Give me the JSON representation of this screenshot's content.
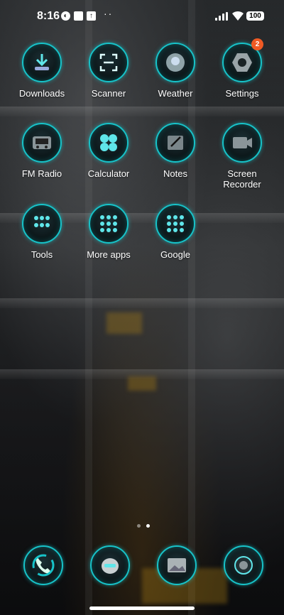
{
  "status_bar": {
    "time": "8:16",
    "notif_icons": [
      "assistant-icon",
      "photo-icon",
      "upload-icon"
    ],
    "battery": "100"
  },
  "apps": [
    {
      "label": "Downloads",
      "icon": "download-icon"
    },
    {
      "label": "Scanner",
      "icon": "scanner-icon"
    },
    {
      "label": "Weather",
      "icon": "weather-icon"
    },
    {
      "label": "Settings",
      "icon": "gear-icon",
      "badge": "2"
    },
    {
      "label": "FM Radio",
      "icon": "radio-icon"
    },
    {
      "label": "Calculator",
      "icon": "calculator-icon"
    },
    {
      "label": "Notes",
      "icon": "notes-icon"
    },
    {
      "label": "Screen Recorder",
      "icon": "video-camera-icon"
    },
    {
      "label": "Tools",
      "icon": "tools-folder-icon"
    },
    {
      "label": "More apps",
      "icon": "more-apps-folder-icon"
    },
    {
      "label": "Google",
      "icon": "google-folder-icon"
    }
  ],
  "pager": {
    "pages": 2,
    "active": 2
  },
  "dock": [
    {
      "icon": "phone-icon"
    },
    {
      "icon": "messages-icon"
    },
    {
      "icon": "gallery-icon"
    },
    {
      "icon": "camera-icon"
    }
  ],
  "theme": {
    "accent": "#17c3c9",
    "badge": "#f05a24"
  }
}
